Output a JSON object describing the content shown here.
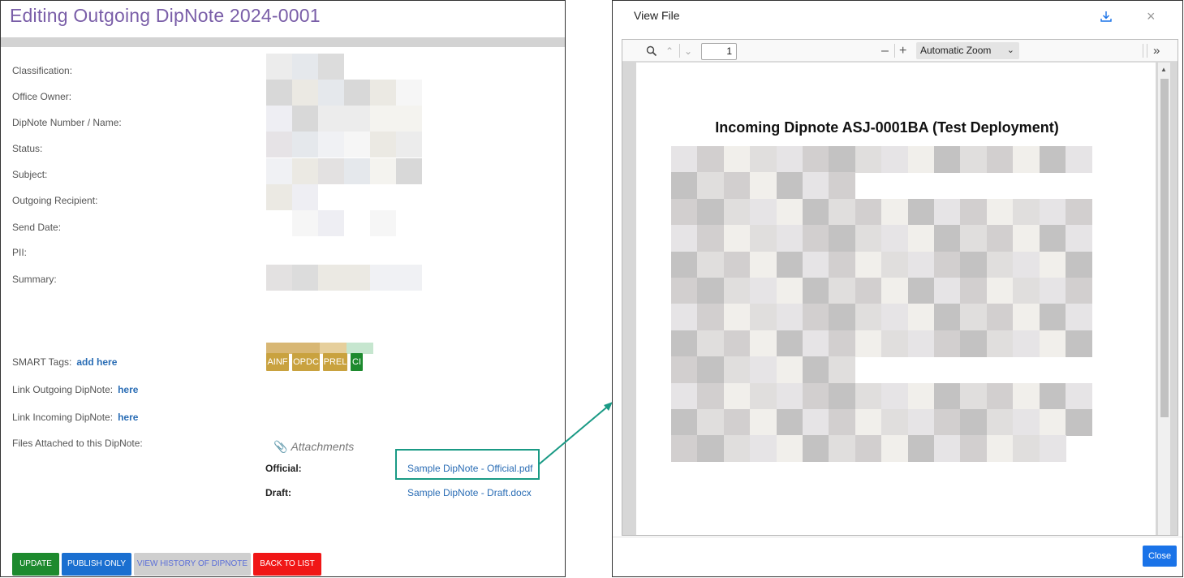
{
  "edit_panel": {
    "title": "Editing Outgoing DipNote 2024-0001",
    "fields": {
      "classification": "Classification:",
      "office_owner": "Office Owner:",
      "dipnote_number": "DipNote Number / Name:",
      "status": "Status:",
      "subject": "Subject:",
      "outgoing_recipient": "Outgoing Recipient:",
      "send_date": "Send Date:",
      "pii": "PII:",
      "summary": "Summary:",
      "smart_tags": "SMART Tags:",
      "smart_tags_link": "add here",
      "link_outgoing": "Link Outgoing DipNote:",
      "link_outgoing_link": "here",
      "link_incoming": "Link Incoming DipNote:",
      "link_incoming_link": "here",
      "files_attached": "Files Attached to this DipNote:"
    },
    "tags": [
      {
        "label": "AINF",
        "color": "#c9a23f"
      },
      {
        "label": "OPDC",
        "color": "#c9a23f"
      },
      {
        "label": "PREL",
        "color": "#c9a23f"
      },
      {
        "label": "CI",
        "color": "#1d8a2e"
      }
    ],
    "attachments": {
      "header": "Attachments",
      "official_label": "Official:",
      "official_file": "Sample DipNote - Official.pdf",
      "draft_label": "Draft:",
      "draft_file": "Sample DipNote - Draft.docx"
    },
    "buttons": {
      "update": "UPDATE",
      "publish_only": "PUBLISH ONLY",
      "view_history": "VIEW HISTORY OF DIPNOTE",
      "back_to_list": "BACK TO LIST"
    }
  },
  "view_modal": {
    "title": "View File",
    "toolbar": {
      "page_number": "1",
      "zoom": "Automatic Zoom"
    },
    "document_title": "Incoming Dipnote ASJ-0001BA (Test Deployment)",
    "close_button": "Close"
  },
  "colors": {
    "title_purple": "#7a5ea8",
    "link_blue": "#2a6db5",
    "highlight_teal": "#1a9a85",
    "update_green": "#1d8a2e",
    "publish_blue": "#1a6fd0",
    "back_red": "#f01616"
  }
}
